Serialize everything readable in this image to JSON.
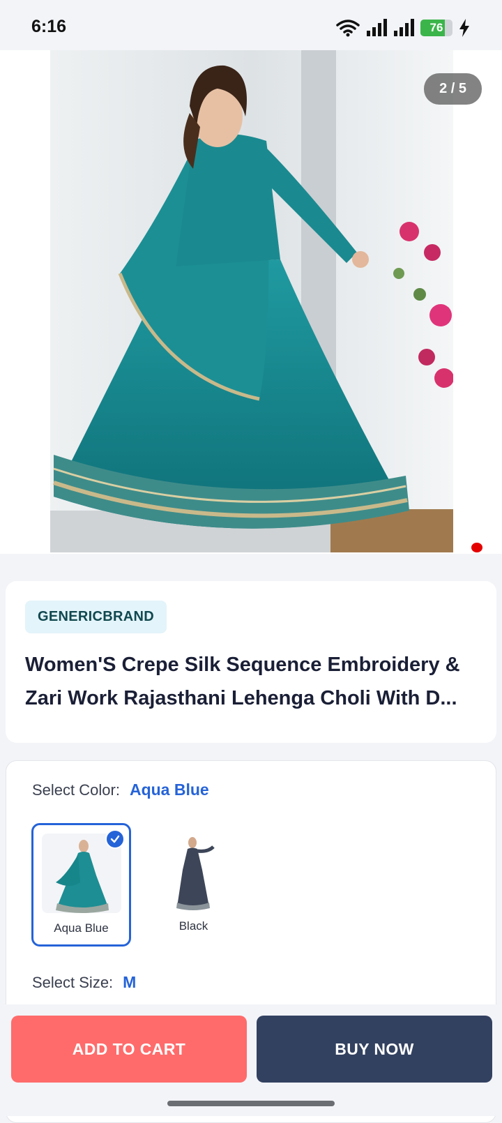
{
  "status_bar": {
    "time": "6:16",
    "battery_level": "76",
    "icons": [
      "wifi-icon",
      "signal-icon",
      "signal-icon",
      "battery-icon",
      "charging-icon"
    ]
  },
  "gallery": {
    "counter": "2 / 5",
    "current_index": 2,
    "total": 5
  },
  "product": {
    "brand": "GENERICBRAND",
    "title": "Women'S Crepe Silk Sequence Embroidery & Zari Work Rajasthani Lehenga Choli With D..."
  },
  "variants": {
    "color_label": "Select Color:",
    "color_value": "Aqua Blue",
    "colors": [
      {
        "name": "Aqua Blue",
        "selected": true,
        "swatch_color": "#1d8e93"
      },
      {
        "name": "Black",
        "selected": false,
        "swatch_color": "#3d4658"
      }
    ],
    "size_label": "Select Size:",
    "size_value": "M"
  },
  "actions": {
    "add_to_cart": "ADD TO CART",
    "buy_now": "BUY NOW"
  },
  "colors": {
    "accent": "#2563d8",
    "cart_button": "#ff6b6b",
    "buy_button": "#334160",
    "brand_tag_bg": "#e3f4fa"
  }
}
